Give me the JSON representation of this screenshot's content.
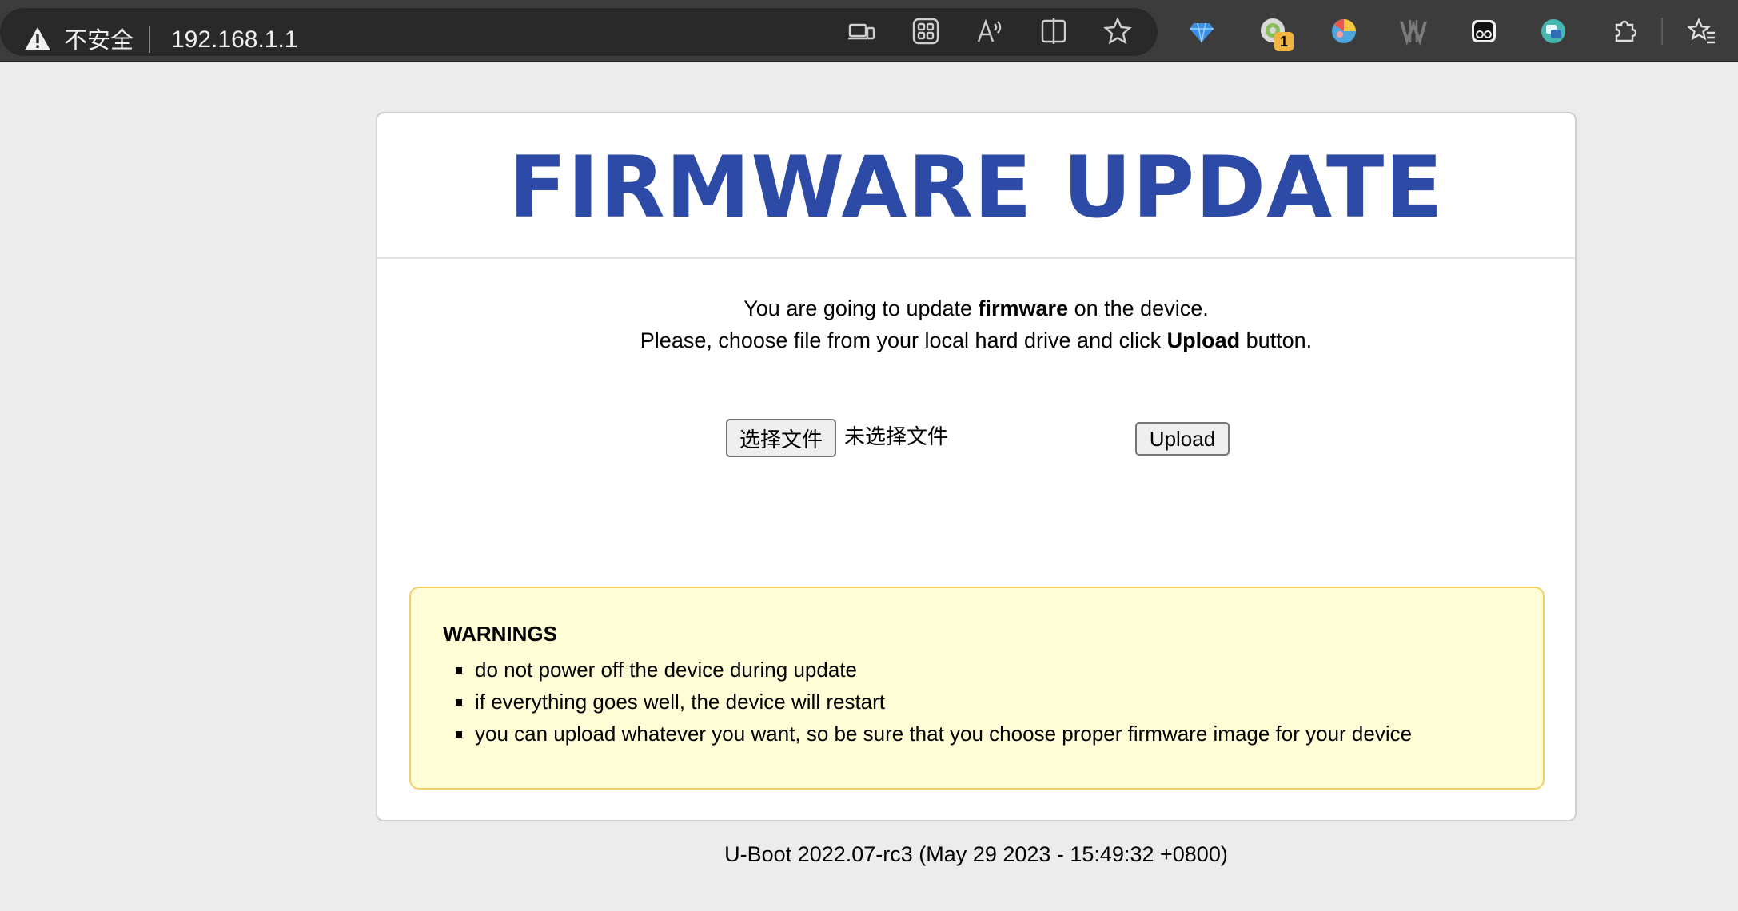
{
  "browser": {
    "security_label": "不安全",
    "url": "192.168.1.1",
    "extension_badge": "1",
    "toolbar_icons": [
      "device-icon",
      "apps-icon",
      "read-aloud-icon",
      "split-screen-icon",
      "favorite-star-icon"
    ],
    "extension_icons": [
      "gem-extension-icon",
      "extension-with-badge-icon",
      "colorful-extension-icon",
      "w-extension-icon",
      "face-extension-icon",
      "translate-extension-icon",
      "puzzle-extensions-icon",
      "favorites-icon"
    ]
  },
  "page": {
    "title": "FIRMWARE UPDATE",
    "intro_line1_before": "You are going to update ",
    "intro_line1_bold": "firmware",
    "intro_line1_after": " on the device.",
    "intro_line2_before": "Please, choose file from your local hard drive and click ",
    "intro_line2_bold": "Upload",
    "intro_line2_after": " button.",
    "file_button_label": "选择文件",
    "file_status": "未选择文件",
    "upload_button_label": "Upload",
    "warnings_title": "WARNINGS",
    "warnings": [
      "do not power off the device during update",
      "if everything goes well, the device will restart",
      "you can upload whatever you want, so be sure that you choose proper firmware image for your device"
    ],
    "footer": "U-Boot 2022.07-rc3 (May 29 2023 - 15:49:32 +0800)"
  },
  "colors": {
    "title": "#2c4aa6",
    "warning_background": "#fffdd6",
    "warning_border": "#f3cf6a"
  }
}
